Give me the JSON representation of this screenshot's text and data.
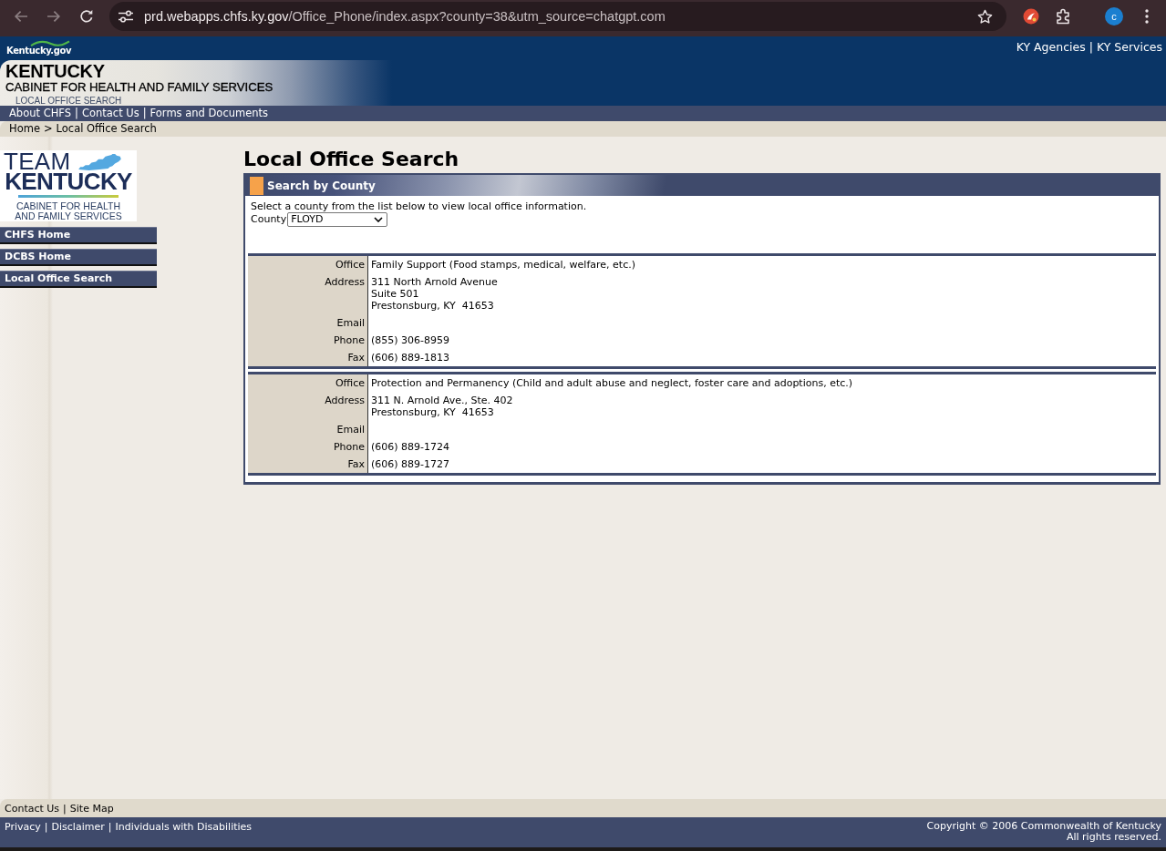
{
  "browser": {
    "url_host": "prd.webapps.chfs.ky.gov",
    "url_path": "/Office_Phone/index.aspx?county=38&utm_source=chatgpt.com",
    "profile_initial": "c"
  },
  "top_bar": {
    "logo": "Kentucky.gov",
    "links": [
      "KY Agencies",
      "KY Services"
    ],
    "separator": "|"
  },
  "banner": {
    "title": "KENTUCKY",
    "subtitle": "CABINET FOR HEALTH AND FAMILY SERVICES",
    "section": "LOCAL OFFICE SEARCH"
  },
  "nav_bar": {
    "links": [
      "About CHFS",
      "Contact Us",
      "Forms and Documents"
    ],
    "separator": "|"
  },
  "breadcrumb": {
    "items": [
      "Home",
      "Local Office Search"
    ],
    "separator": ">"
  },
  "sidebar": {
    "logo": {
      "line_1": "TEAM",
      "line_2": "KENTUCKY",
      "line_3": "CABINET FOR HEALTH",
      "line_4": "AND FAMILY SERVICES"
    },
    "items": [
      {
        "label": "CHFS Home"
      },
      {
        "label": "DCBS Home"
      },
      {
        "label": "Local Office Search"
      }
    ]
  },
  "main": {
    "heading": "Local Office Search",
    "panel": {
      "title": "Search by County",
      "instructions": "Select a county from the list below to view local office information.",
      "county_label": "County",
      "county_value": "FLOYD",
      "offices": [
        {
          "fields": [
            {
              "label": "Office",
              "lines": [
                "Family Support (Food stamps, medical, welfare, etc.)"
              ]
            },
            {
              "label": "Address",
              "lines": [
                "311 North Arnold Avenue",
                "Suite 501",
                "Prestonsburg, KY  41653"
              ]
            },
            {
              "label": "Email"
            },
            {
              "label": "Phone",
              "lines": [
                "(855) 306-8959"
              ]
            },
            {
              "label": "Fax",
              "lines": [
                "(606) 889-1813"
              ]
            }
          ]
        },
        {
          "fields": [
            {
              "label": "Office",
              "lines": [
                "Protection and Permanency (Child and adult abuse and neglect, foster care and adoptions, etc.)"
              ]
            },
            {
              "label": "Address",
              "lines": [
                "311 N. Arnold Ave., Ste. 402",
                "Prestonsburg, KY  41653"
              ]
            },
            {
              "label": "Email"
            },
            {
              "label": "Phone",
              "lines": [
                "(606) 889-1724"
              ]
            },
            {
              "label": "Fax",
              "lines": [
                "(606) 889-1727"
              ]
            }
          ]
        }
      ]
    }
  },
  "footer": {
    "top_links": [
      "Contact Us",
      "Site Map"
    ],
    "bottom_links": [
      "Privacy",
      "Disclaimer",
      "Individuals with Disabilities"
    ],
    "separator": "|",
    "copyright": [
      "Copyright © 2006 Commonwealth of Kentucky",
      "All rights reserved."
    ]
  }
}
